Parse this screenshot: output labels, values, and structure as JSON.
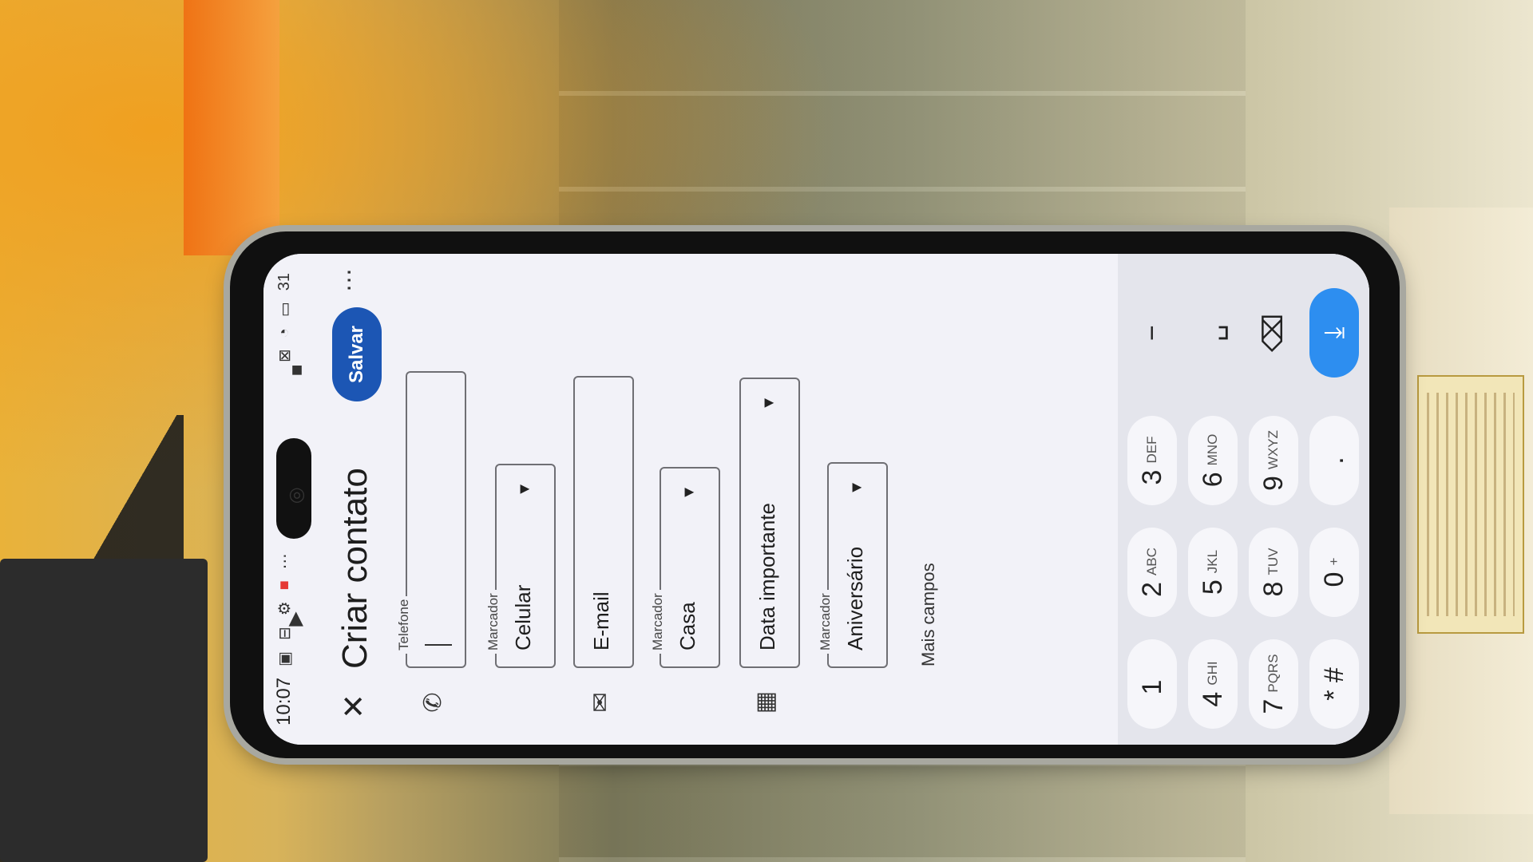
{
  "status_bar": {
    "time": "10:07",
    "left_icons": [
      "sim-icon",
      "download-icon",
      "gear-icon",
      "notification-icon",
      "more-dots-icon"
    ],
    "right_icons": [
      "screenshot-icon",
      "wifi-icon",
      "battery-icon"
    ],
    "battery": "31"
  },
  "app_bar": {
    "close_icon": "✕",
    "title": "Criar contato",
    "save_label": "Salvar",
    "more_icon": "⋯"
  },
  "form": {
    "phone": {
      "label": "Telefone",
      "value": ""
    },
    "phone_type": {
      "label": "Marcador",
      "value": "Celular"
    },
    "email": {
      "placeholder": "E-mail"
    },
    "email_type": {
      "label": "Marcador",
      "value": "Casa"
    },
    "important_date": {
      "placeholder": "Data importante"
    },
    "date_type": {
      "label": "Marcador",
      "value": "Aniversário"
    },
    "more_fields": "Mais campos"
  },
  "keyboard": {
    "rows": [
      [
        {
          "main": "1",
          "sub": ""
        },
        {
          "main": "2",
          "sub": "ABC"
        },
        {
          "main": "3",
          "sub": "DEF"
        },
        {
          "main": "−",
          "sub": ""
        }
      ],
      [
        {
          "main": "4",
          "sub": "GHI"
        },
        {
          "main": "5",
          "sub": "JKL"
        },
        {
          "main": "6",
          "sub": "MNO"
        },
        {
          "main": "␣",
          "sub": ""
        }
      ],
      [
        {
          "main": "7",
          "sub": "PQRS"
        },
        {
          "main": "8",
          "sub": "TUV"
        },
        {
          "main": "9",
          "sub": "WXYZ"
        },
        {
          "main": "⌫",
          "sub": ""
        }
      ],
      [
        {
          "main": "* #",
          "sub": ""
        },
        {
          "main": "0",
          "sub": "+"
        },
        {
          "main": ".",
          "sub": ""
        },
        {
          "main": "⤓",
          "sub": ""
        }
      ]
    ]
  },
  "nav_bar": {
    "back": "◀",
    "home": "◎",
    "recents": "■"
  },
  "colors": {
    "save": "#1c56b4",
    "enter": "#2d8ef0",
    "screen_bg": "#f2f2f8"
  }
}
